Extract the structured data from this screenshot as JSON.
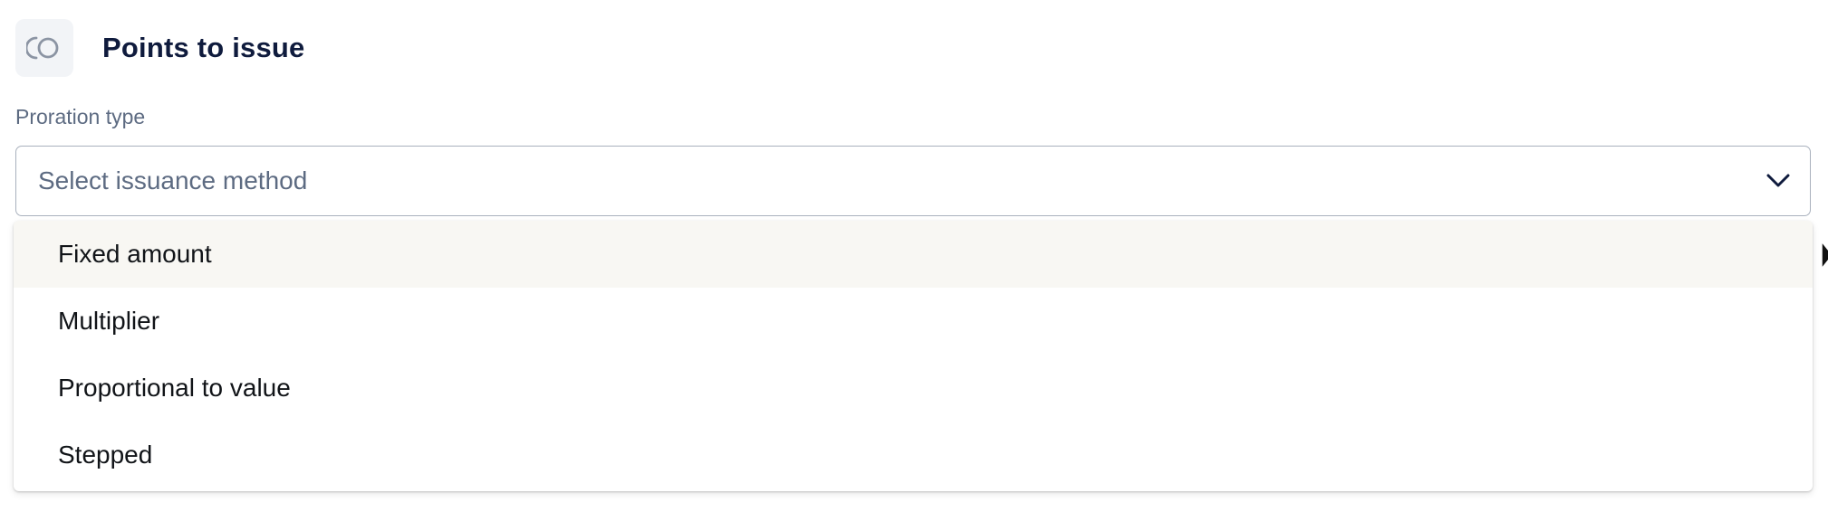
{
  "section": {
    "title": "Points to issue",
    "icon": "points-toggle-icon"
  },
  "proration": {
    "label": "Proration type",
    "placeholder": "Select issuance method",
    "chevron_icon": "chevron-down-icon",
    "options": [
      {
        "label": "Fixed amount",
        "highlighted": true
      },
      {
        "label": "Multiplier",
        "highlighted": false
      },
      {
        "label": "Proportional to value",
        "highlighted": false
      },
      {
        "label": "Stepped",
        "highlighted": false
      }
    ]
  },
  "colors": {
    "title": "#0f1b3d",
    "label": "#5d6b82",
    "highlight": "#f8f7f3",
    "border": "#a9b1bd"
  }
}
